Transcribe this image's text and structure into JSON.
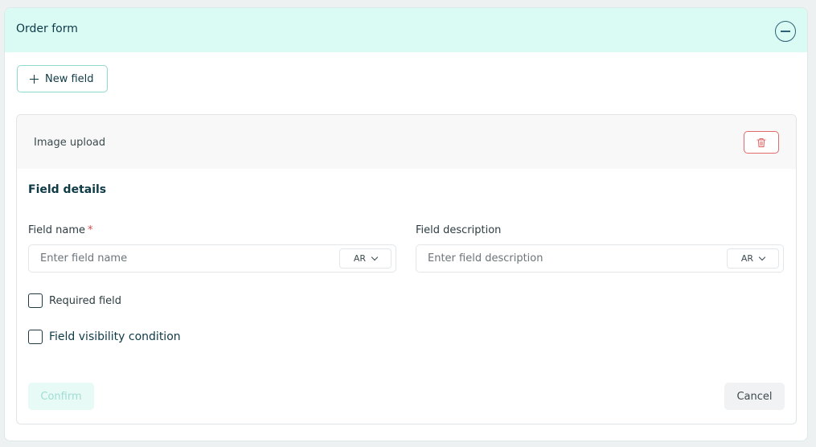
{
  "panel": {
    "title": "Order form",
    "collapse_icon": "minus-circle-icon",
    "new_field_label": "New field"
  },
  "field_card": {
    "title": "Image upload",
    "delete_icon": "trash-icon",
    "section_title": "Field details",
    "field_name": {
      "label": "Field name",
      "required_mark": "*",
      "placeholder": "Enter field name",
      "value": "",
      "language": "AR"
    },
    "field_description": {
      "label": "Field description",
      "placeholder": "Enter field description",
      "value": "",
      "language": "AR"
    },
    "required_checkbox": {
      "label": "Required field",
      "checked": false
    },
    "visibility_checkbox": {
      "label": "Field visibility condition",
      "checked": false
    },
    "confirm_label": "Confirm",
    "cancel_label": "Cancel"
  },
  "colors": {
    "header_bg": "#dafbf4",
    "accent_border": "#8fd9cf",
    "danger": "#e16a6a",
    "confirm_disabled_bg": "#e7faf6",
    "confirm_disabled_text": "#9fded2",
    "text_dark": "#0e3a46"
  }
}
